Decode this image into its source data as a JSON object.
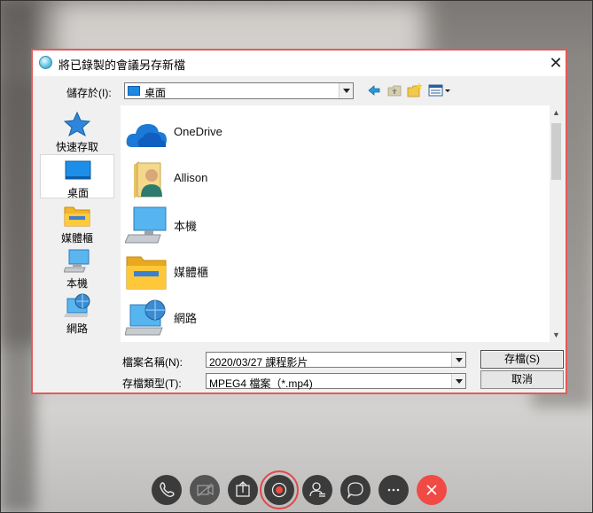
{
  "dialog": {
    "title": "將已錄製的會議另存新檔",
    "save_in_label": "儲存於(I):",
    "save_in_value": "桌面",
    "filename_label": "檔案名稱(N):",
    "filename_value": "2020/03/27 課程影片",
    "filetype_label": "存檔類型(T):",
    "filetype_value": "MPEG4 檔案（*.mp4)",
    "save_button": "存檔(S)",
    "cancel_button": "取消"
  },
  "places": [
    {
      "label": "快速存取",
      "icon": "star-icon"
    },
    {
      "label": "桌面",
      "icon": "desktop-icon",
      "selected": true
    },
    {
      "label": "媒體櫃",
      "icon": "library-icon"
    },
    {
      "label": "本機",
      "icon": "computer-icon"
    },
    {
      "label": "網路",
      "icon": "network-icon"
    }
  ],
  "files": [
    {
      "name": "OneDrive",
      "icon": "cloud-icon"
    },
    {
      "name": "Allison",
      "icon": "user-folder-icon"
    },
    {
      "name": "本機",
      "icon": "computer-icon"
    },
    {
      "name": "媒體櫃",
      "icon": "library-icon"
    },
    {
      "name": "網路",
      "icon": "network-icon"
    }
  ],
  "toolbar_icons": [
    "back-arrow-icon",
    "up-folder-icon",
    "new-folder-icon",
    "view-menu-icon"
  ],
  "call_controls": [
    "phone-icon",
    "video-off-icon",
    "share-icon",
    "record-icon",
    "participants-icon",
    "chat-icon",
    "more-icon",
    "end-call-icon"
  ],
  "colors": {
    "accent_red": "#e25a5a",
    "end_call": "#f04a45",
    "control_bg": "#3b3b3b"
  }
}
